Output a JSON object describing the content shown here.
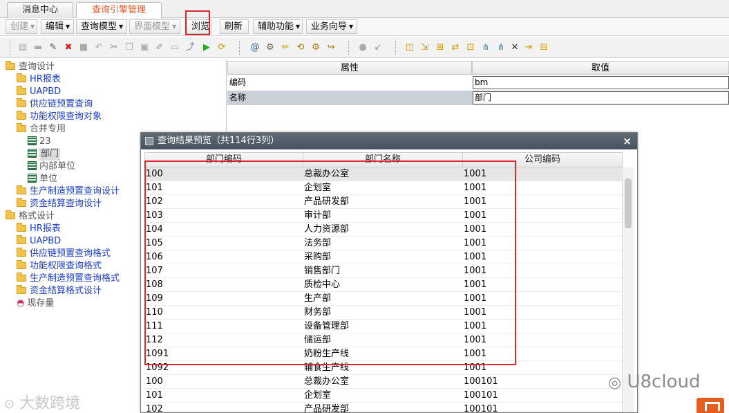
{
  "tabs": [
    {
      "label": "消息中心",
      "active": false
    },
    {
      "label": "查询引擎管理",
      "active": true
    }
  ],
  "menu": {
    "create": "创建",
    "edit": "编辑",
    "query_model": "查询模型",
    "ui_model": "界面模型",
    "browse": "浏览",
    "refresh": "刷新",
    "aux": "辅助功能",
    "wizard": "业务向导"
  },
  "icons": [
    "open-icon",
    "folder-icon",
    "edit-icon",
    "delete-icon",
    "stop-icon",
    "undo-icon",
    "cut-icon",
    "copy-icon",
    "paste-icon",
    "format-icon",
    "save-icon",
    "export-icon",
    "run-icon",
    "refresh-icon",
    "at-icon",
    "settings-icon",
    "pencil-icon",
    "sync-icon",
    "gears-icon",
    "link-icon",
    "record-icon",
    "arrow-icon",
    "cube-icon",
    "flow-icon",
    "tree-icon",
    "move-icon",
    "chart-icon",
    "branch-icon",
    "branch2-icon",
    "cross-icon",
    "import-icon",
    "lock-icon"
  ],
  "tree": {
    "query_design": "查询设计",
    "hr_report": "HR报表",
    "uapbd": "UAPBD",
    "supply_chain": "供应链预置查询",
    "func_permission": "功能权限查询对象",
    "merge": "合并专用",
    "n23": "23",
    "dept": "部门",
    "inner_unit": "内部单位",
    "unit": "单位",
    "mfg": "生产制造预置查询设计",
    "fund": "资金结算查询设计",
    "format_design": "格式设计",
    "hr_report2": "HR报表",
    "uapbd2": "UAPBD",
    "supply_fmt": "供应链预置查询格式",
    "func_fmt": "功能权限查询格式",
    "mfg_fmt": "生产制造预置查询格式",
    "fund_fmt": "资金结算格式设计",
    "stock": "现存量"
  },
  "props": {
    "header_attr": "属性",
    "header_value": "取值",
    "rows": [
      {
        "name": "编码",
        "value": "bm"
      },
      {
        "name": "名称",
        "value": "部门"
      }
    ]
  },
  "dialog": {
    "title": "查询结果预览（共114行3列）",
    "close": "×",
    "columns": [
      "部门编码",
      "部门名称",
      "公司编码"
    ],
    "rows": [
      [
        "100",
        "总裁办公室",
        "1001"
      ],
      [
        "101",
        "企划室",
        "1001"
      ],
      [
        "102",
        "产品研发部",
        "1001"
      ],
      [
        "103",
        "审计部",
        "1001"
      ],
      [
        "104",
        "人力资源部",
        "1001"
      ],
      [
        "105",
        "法务部",
        "1001"
      ],
      [
        "106",
        "采购部",
        "1001"
      ],
      [
        "107",
        "销售部门",
        "1001"
      ],
      [
        "108",
        "质检中心",
        "1001"
      ],
      [
        "109",
        "生产部",
        "1001"
      ],
      [
        "110",
        "财务部",
        "1001"
      ],
      [
        "111",
        "设备管理部",
        "1001"
      ],
      [
        "112",
        "储运部",
        "1001"
      ],
      [
        "1091",
        "奶粉生产线",
        "1001"
      ],
      [
        "1092",
        "辅食生产线",
        "1001"
      ],
      [
        "100",
        "总裁办公室",
        "100101"
      ],
      [
        "101",
        "企划室",
        "100101"
      ],
      [
        "102",
        "产品研发部",
        "100101"
      ]
    ]
  },
  "watermarks": {
    "left": "大数跨境",
    "right": "U8cloud"
  },
  "colors": {
    "highlight_box": "#e0262a",
    "active_tab": "#e05a2a",
    "tree_link": "#1a3cc0",
    "dialog_title_bg": "#4f5a65"
  }
}
